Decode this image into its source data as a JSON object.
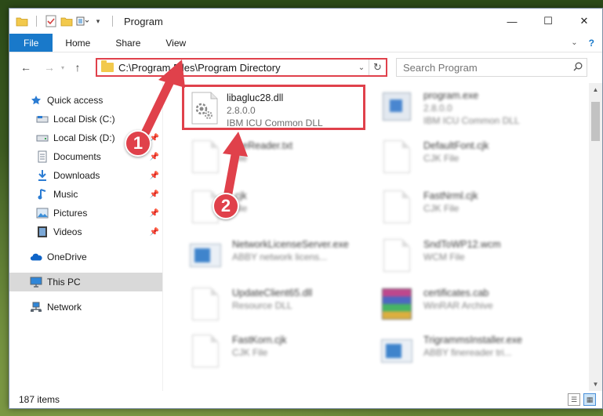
{
  "window": {
    "title": "Program"
  },
  "ribbon": {
    "file": "File",
    "home": "Home",
    "share": "Share",
    "view": "View"
  },
  "address": {
    "path": "C:\\Program Files\\Program Directory"
  },
  "search": {
    "placeholder": "Search Program"
  },
  "sidebar": {
    "items": [
      {
        "label": "Quick access",
        "icon": "star-icon"
      },
      {
        "label": "Local Disk (C:)",
        "icon": "drive-icon"
      },
      {
        "label": "Local Disk (D:)",
        "icon": "drive-icon"
      },
      {
        "label": "Documents",
        "icon": "documents-icon"
      },
      {
        "label": "Downloads",
        "icon": "download-icon"
      },
      {
        "label": "Music",
        "icon": "music-icon"
      },
      {
        "label": "Pictures",
        "icon": "pictures-icon"
      },
      {
        "label": "Videos",
        "icon": "videos-icon"
      },
      {
        "label": "OneDrive",
        "icon": "cloud-icon"
      },
      {
        "label": "This PC",
        "icon": "computer-icon"
      },
      {
        "label": "Network",
        "icon": "network-icon"
      }
    ]
  },
  "files": [
    {
      "name": "libagluc28.dll",
      "line1": "2.8.0.0",
      "line2": "IBM ICU Common DLL",
      "icon": "dll-gear-icon"
    },
    {
      "name": "program.exe",
      "line1": "2.8.0.0",
      "line2": "IBM ICU Common DLL",
      "icon": "exe-icon"
    },
    {
      "name": "fineReader.txt",
      "line1": "File",
      "line2": "",
      "icon": "document-icon"
    },
    {
      "name": "DefaultFont.cjk",
      "line1": "CJK File",
      "line2": "",
      "icon": "document-icon"
    },
    {
      "name": ".cjk",
      "line1": "File",
      "line2": "",
      "icon": "document-icon"
    },
    {
      "name": "FastNrml.cjk",
      "line1": "CJK File",
      "line2": "",
      "icon": "document-icon"
    },
    {
      "name": "NetworkLicenseServer.exe",
      "line1": "ABBY network licens...",
      "line2": "",
      "icon": "network-exe-icon"
    },
    {
      "name": "SndToWP12.wcm",
      "line1": "WCM File",
      "line2": "",
      "icon": "document-icon"
    },
    {
      "name": "UpdateClient65.dll",
      "line1": "Resource DLL",
      "line2": "",
      "icon": "document-icon"
    },
    {
      "name": "certificates.cab",
      "line1": "WinRAR Archive",
      "line2": "",
      "icon": "winrar-icon"
    },
    {
      "name": "FastKorn.cjk",
      "line1": "CJK File",
      "line2": "",
      "icon": "document-icon"
    },
    {
      "name": "TrigrammsInstaller.exe",
      "line1": "ABBY finereader tri...",
      "line2": "",
      "icon": "network-exe-icon"
    }
  ],
  "status": {
    "count": "187 items"
  },
  "annotations": {
    "step1": "1",
    "step2": "2"
  },
  "colors": {
    "accent": "#1979ca",
    "highlight": "#e0414b"
  }
}
